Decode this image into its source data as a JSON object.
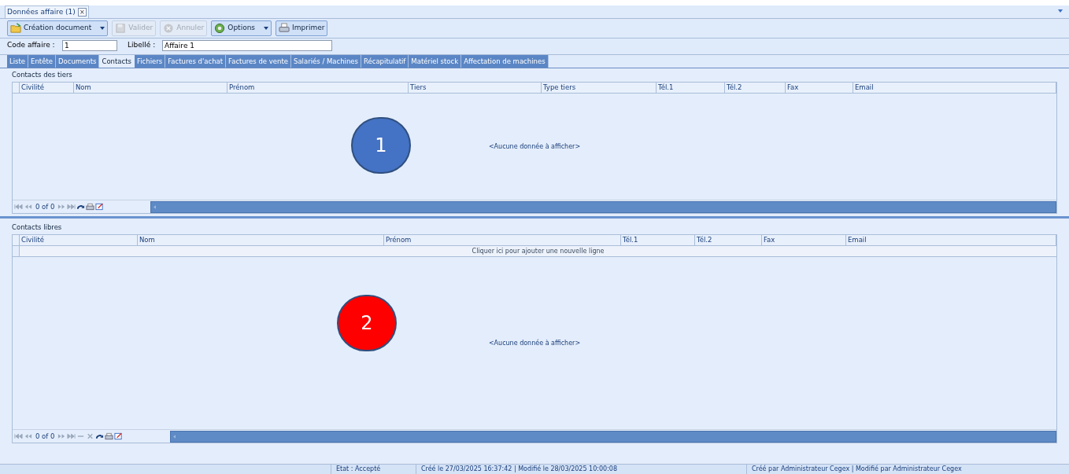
{
  "document_tab": {
    "title": "Données affaire (1)",
    "close": "×"
  },
  "toolbar": [
    {
      "label": "Création document",
      "kind": "dropdown",
      "disabled": false
    },
    {
      "label": "Valider",
      "kind": "button",
      "disabled": true
    },
    {
      "label": "Annuler",
      "kind": "button",
      "disabled": true
    },
    {
      "label": "Options",
      "kind": "dropdown",
      "disabled": false
    },
    {
      "label": "Imprimer",
      "kind": "button",
      "disabled": false
    }
  ],
  "fields": [
    {
      "label": "Code affaire :",
      "value": "1"
    },
    {
      "label": "Libellé :",
      "value": "Affaire 1"
    }
  ],
  "tabs": [
    {
      "label": "Liste",
      "selected": false
    },
    {
      "label": "Entête",
      "selected": false
    },
    {
      "label": "Documents",
      "selected": false
    },
    {
      "label": "Contacts",
      "selected": true
    },
    {
      "label": "Fichiers",
      "selected": false
    },
    {
      "label": "Factures d'achat",
      "selected": false
    },
    {
      "label": "Factures de vente",
      "selected": false
    },
    {
      "label": "Salariés / Machines",
      "selected": false
    },
    {
      "label": "Récapitulatif",
      "selected": false
    },
    {
      "label": "Matériel stock",
      "selected": false
    },
    {
      "label": "Affectation de machines",
      "selected": false
    }
  ],
  "grids": [
    {
      "title": "Contacts des tiers",
      "columns": [
        "Civilité",
        "Nom",
        "Prénom",
        "Tiers",
        "Type tiers",
        "Tél.1",
        "Tél.2",
        "Fax",
        "Email"
      ],
      "empty_text": "<Aucune donnée à afficher>",
      "pager": "0 of 0",
      "can_delete": false,
      "marker": {
        "label": "1",
        "color": "#4472c4"
      }
    },
    {
      "title": "Contacts libres",
      "columns": [
        "Civilité",
        "Nom",
        "Prénom",
        "Tél.1",
        "Tél.2",
        "Fax",
        "Email"
      ],
      "new_row": "Cliquer ici pour ajouter une nouvelle ligne",
      "empty_text": "<Aucune donnée à afficher>",
      "pager": "0 of 0",
      "can_delete": true,
      "marker": {
        "label": "2",
        "color": "#ff0000"
      }
    }
  ],
  "status_bar": [
    "Etat : Accepté",
    "Créé le 27/03/2025 16:37:42 | Modifié le 28/03/2025 10:00:08",
    "Créé par Administrateur Cegex | Modifié par Administrateur Cegex"
  ]
}
